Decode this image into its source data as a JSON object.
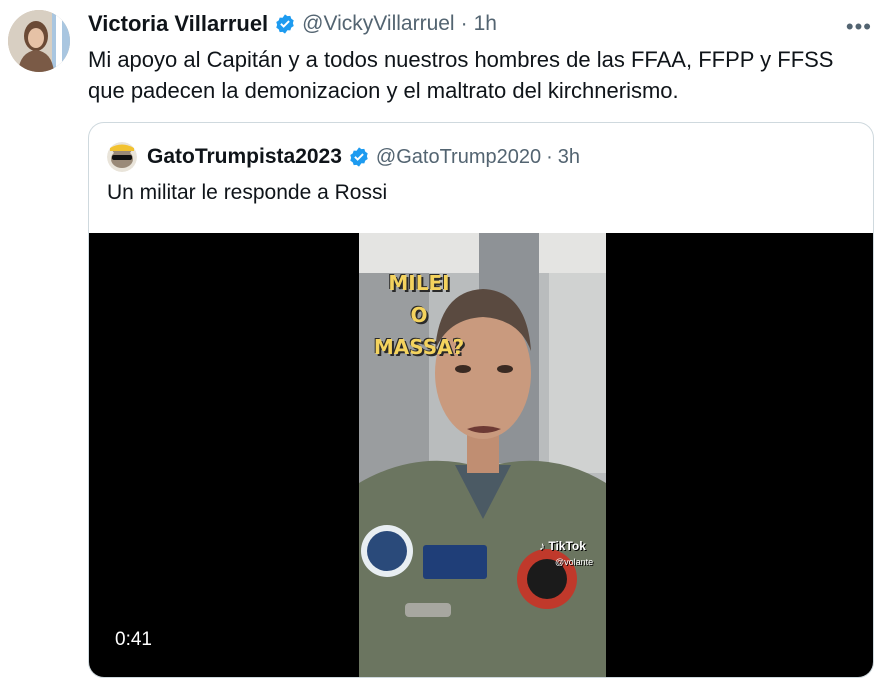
{
  "tweet": {
    "display_name": "Victoria Villarruel",
    "handle": "@VickyVillarruel",
    "separator": "·",
    "time": "1h",
    "more_label": "•••",
    "text_line1": "Mi apoyo al Capitán y a todos nuestros hombres de las FFAA, FFPP y FFSS",
    "text_line2": "que padecen la demonizacion y el maltrato del kirchnerismo."
  },
  "quoted": {
    "display_name": "GatoTrumpista2023",
    "handle": "@GatoTrump2020",
    "separator": "·",
    "time": "3h",
    "text": "Un militar le responde a Rossi",
    "video": {
      "duration": "0:41",
      "overlay_line1": "MILEI",
      "overlay_line2": "O",
      "overlay_line3": "MASSA?",
      "watermark": "TikTok",
      "watermark_user": "@volante"
    }
  },
  "colors": {
    "verified": "#1d9bf0",
    "text": "#0f1419",
    "secondary": "#536471",
    "border": "#cfd9de",
    "overlay_text": "#f4d35e"
  },
  "icons": {
    "verified": "verified-badge-icon",
    "more": "more-options-icon"
  }
}
